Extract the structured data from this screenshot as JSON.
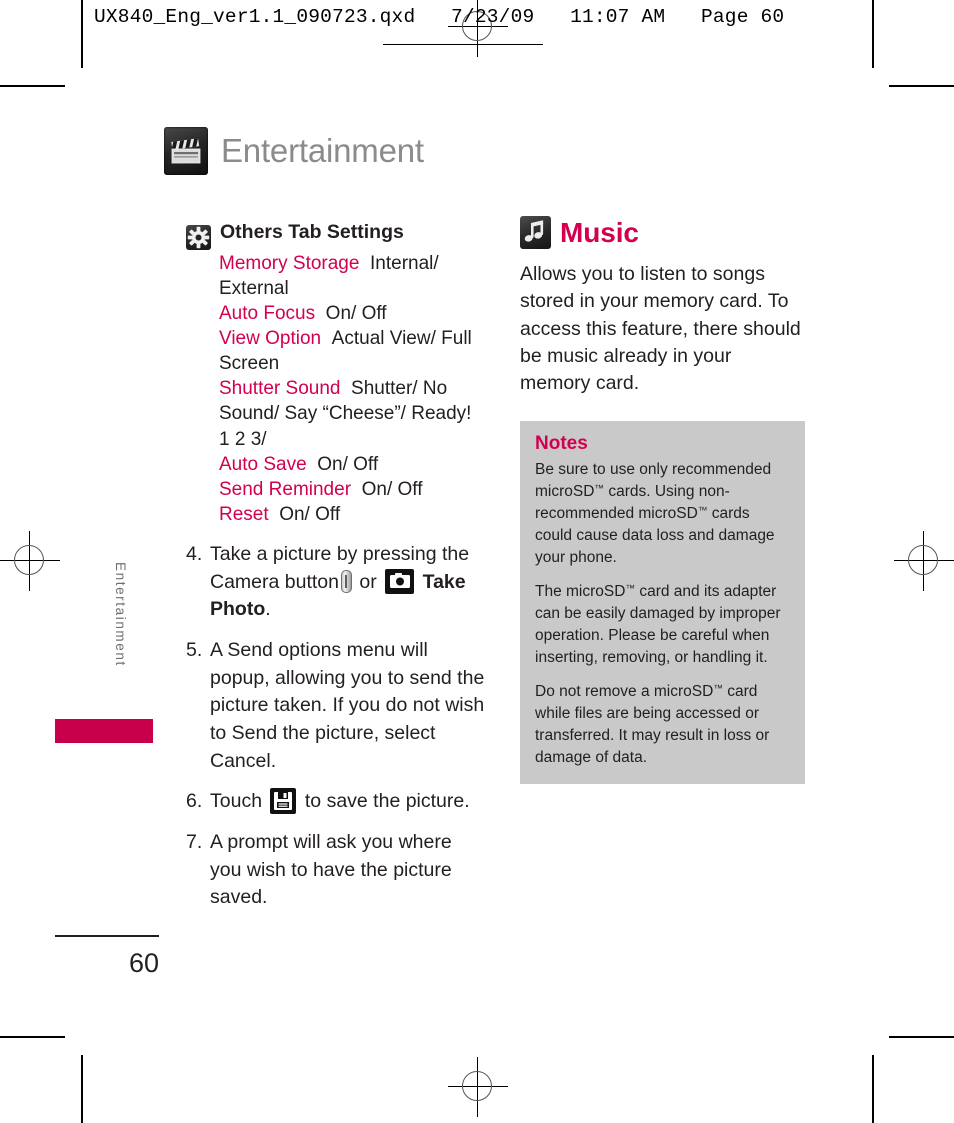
{
  "slugline": "UX840_Eng_ver1.1_090723.qxd   7/23/09   11:07 AM   Page 60",
  "section": {
    "title": "Entertainment",
    "icon": "clapperboard-icon"
  },
  "side_tab": {
    "label": "Entertainment"
  },
  "folio": {
    "page_number": "60"
  },
  "left_column": {
    "sub_head": {
      "icon": "gear-icon",
      "label": "Others Tab Settings"
    },
    "settings": [
      {
        "term": "Memory Storage",
        "def": "Internal/ External"
      },
      {
        "term": "Auto Focus",
        "def": "On/ Off"
      },
      {
        "term": "View Option",
        "def": "Actual View/ Full Screen"
      },
      {
        "term": "Shutter Sound",
        "def": "Shutter/ No Sound/ Say “Cheese”/ Ready! 1 2 3/"
      },
      {
        "term": "Auto Save",
        "def": "On/ Off"
      },
      {
        "term": "Send Reminder",
        "def": "On/ Off"
      },
      {
        "term": "Reset",
        "def": "On/ Off"
      }
    ],
    "steps": [
      {
        "num": "4.",
        "part1": "Take a picture by pressing the Camera button",
        "icon1": "camera-button-icon",
        "part2": "or",
        "icon2": "camera-icon",
        "bold": "Take Photo",
        "part3": "."
      },
      {
        "num": "5.",
        "text": "A Send options menu will popup, allowing you to send the picture taken. If you do not wish to Send the picture, select Cancel."
      },
      {
        "num": "6.",
        "part1": "Touch",
        "icon1": "save-floppy-icon",
        "part2": "to save the picture."
      },
      {
        "num": "7.",
        "text": "A prompt will ask you where you wish to have the picture saved."
      }
    ]
  },
  "right_column": {
    "feature": {
      "icon": "music-note-icon",
      "title": "Music",
      "description": "Allows you to listen to songs stored in your memory card. To access this feature, there should be music already in your memory card."
    },
    "notes": {
      "title": "Notes",
      "paragraphs": [
        "Be sure to use only recommended microSD™ cards. Using non-recommended microSD™ cards could cause data loss and damage your phone.",
        "The microSD™ card and its adapter can be easily damaged by improper operation. Please be careful when inserting, removing, or handling it.",
        "Do not remove a microSD™ card while files are being accessed or transferred. It may result in loss or damage of data."
      ]
    }
  },
  "colors": {
    "accent_magenta": "#d2004f",
    "tab_magenta": "#c8004c",
    "section_title_gray": "#8b8b8b",
    "notes_background": "#c9c9c9",
    "body_text": "#231f20"
  }
}
